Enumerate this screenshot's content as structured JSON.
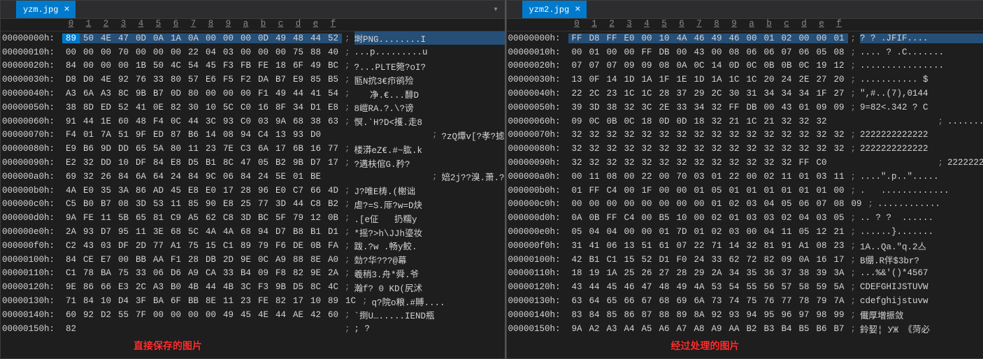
{
  "left": {
    "tab": "yzm.jpg",
    "ruler": [
      "0",
      "1",
      "2",
      "3",
      "4",
      "5",
      "6",
      "7",
      "8",
      "9",
      "a",
      "b",
      "c",
      "d",
      "e",
      "f"
    ],
    "rows": [
      {
        "off": "00000000h:",
        "hex": [
          "89",
          "50",
          "4E",
          "47",
          "0D",
          "0A",
          "1A",
          "0A",
          "00",
          "00",
          "00",
          "0D",
          "49",
          "48",
          "44",
          "52"
        ],
        "asc": "埘PNG........I"
      },
      {
        "off": "00000010h:",
        "hex": [
          "00",
          "00",
          "00",
          "70",
          "00",
          "00",
          "00",
          "22",
          "04",
          "03",
          "00",
          "00",
          "00",
          "75",
          "88",
          "40"
        ],
        "asc": "...p.........u"
      },
      {
        "off": "00000020h:",
        "hex": [
          "84",
          "00",
          "00",
          "00",
          "1B",
          "50",
          "4C",
          "54",
          "45",
          "F3",
          "FB",
          "FE",
          "18",
          "6F",
          "49",
          "BC"
        ],
        "asc": "?...PLTE箢?oI?"
      },
      {
        "off": "00000030h:",
        "hex": [
          "D8",
          "D0",
          "4E",
          "92",
          "76",
          "33",
          "80",
          "57",
          "E6",
          "F5",
          "F2",
          "DA",
          "B7",
          "E9",
          "85",
          "B5"
        ],
        "asc": "匦N抭3€疖鹆殓"
      },
      {
        "off": "00000040h:",
        "hex": [
          "A3",
          "6A",
          "A3",
          "8C",
          "9B",
          "B7",
          "0D",
          "80",
          "00",
          "00",
          "00",
          "F1",
          "49",
          "44",
          "41",
          "54"
        ],
        "asc": "   净.€...馡D"
      },
      {
        "off": "00000050h:",
        "hex": [
          "38",
          "8D",
          "ED",
          "52",
          "41",
          "0E",
          "82",
          "30",
          "10",
          "5C",
          "C0",
          "16",
          "8F",
          "34",
          "D1",
          "E8"
        ],
        "asc": "8嵦RA.?.\\?谤"
      },
      {
        "off": "00000060h:",
        "hex": [
          "91",
          "44",
          "1E",
          "60",
          "48",
          "F4",
          "0C",
          "44",
          "3C",
          "93",
          "C0",
          "03",
          "9A",
          "68",
          "38",
          "63"
        ],
        "asc": "慏.`H?D<擭.走8"
      },
      {
        "off": "00000070h:",
        "hex": [
          "F4",
          "01",
          "7A",
          "51",
          "9F",
          "ED",
          "87",
          "B6",
          "14",
          "08",
          "94",
          "C4",
          "13",
          "93",
          "D0",
          "",
          "",
          "",
          "",
          "",
          ""
        ],
        "asc": "?zQ燂v[?孝?摅"
      },
      {
        "off": "00000080h:",
        "hex": [
          "E9",
          "B6",
          "9D",
          "DD",
          "65",
          "5A",
          "80",
          "11",
          "23",
          "7E",
          "C3",
          "6A",
          "17",
          "6B",
          "16",
          "77"
        ],
        "asc": "楼漭eZ€.#~肱.k"
      },
      {
        "off": "00000090h:",
        "hex": [
          "E2",
          "32",
          "DD",
          "10",
          "DF",
          "84",
          "E8",
          "D5",
          "B1",
          "8C",
          "47",
          "05",
          "B2",
          "9B",
          "D7",
          "17"
        ],
        "asc": "?遘枎倌G.矜?"
      },
      {
        "off": "000000a0h:",
        "hex": [
          "69",
          "32",
          "26",
          "84",
          "6A",
          "64",
          "24",
          "84",
          "9C",
          "06",
          "84",
          "24",
          "5E",
          "01",
          "BE",
          "",
          "",
          "",
          "",
          "",
          ""
        ],
        "asc": "婄2j??溴.萧.?"
      },
      {
        "off": "000000b0h:",
        "hex": [
          "4A",
          "E0",
          "35",
          "3A",
          "86",
          "AD",
          "45",
          "E8",
          "E0",
          "17",
          "28",
          "96",
          "E0",
          "C7",
          "66",
          "4D"
        ],
        "asc": "J?唯E梼.(榭诎"
      },
      {
        "off": "000000c0h:",
        "hex": [
          "C5",
          "B0",
          "B7",
          "08",
          "3D",
          "53",
          "11",
          "85",
          "90",
          "E8",
          "25",
          "77",
          "3D",
          "44",
          "C8",
          "B2"
        ],
        "asc": "虐?=S.厞?w=D炔"
      },
      {
        "off": "000000d0h:",
        "hex": [
          "9A",
          "FE",
          "11",
          "5B",
          "65",
          "81",
          "C9",
          "A5",
          "62",
          "C8",
          "3D",
          "BC",
          "5F",
          "79",
          "12",
          "0B"
        ],
        "asc": ".[e佂   扔糯y"
      },
      {
        "off": "000000e0h:",
        "hex": [
          "2A",
          "93",
          "D7",
          "95",
          "11",
          "3E",
          "68",
          "5C",
          "4A",
          "4A",
          "68",
          "94",
          "D7",
          "B8",
          "B1",
          "D1"
        ],
        "asc": "*摇?>h\\JJh瑬妆"
      },
      {
        "off": "000000f0h:",
        "hex": [
          "C2",
          "43",
          "03",
          "DF",
          "2D",
          "77",
          "A1",
          "75",
          "15",
          "C1",
          "89",
          "79",
          "F6",
          "DE",
          "0B",
          "FA"
        ],
        "asc": "跋.?w .畅y鲛."
      },
      {
        "off": "00000100h:",
        "hex": [
          "84",
          "CE",
          "E7",
          "00",
          "BB",
          "AA",
          "F1",
          "28",
          "DB",
          "2D",
          "9E",
          "0C",
          "A9",
          "88",
          "8E",
          "A0"
        ],
        "asc": "勎?华???@幕"
      },
      {
        "off": "00000110h:",
        "hex": [
          "C1",
          "78",
          "BA",
          "75",
          "33",
          "06",
          "D6",
          "A9",
          "CA",
          "33",
          "B4",
          "09",
          "F8",
          "82",
          "9E",
          "2A"
        ],
        "asc": "羲稍3.舟*舜.爷"
      },
      {
        "off": "00000120h:",
        "hex": [
          "9E",
          "86",
          "66",
          "E3",
          "2C",
          "A3",
          "B0",
          "4B",
          "44",
          "4B",
          "3C",
          "F3",
          "9B",
          "D5",
          "8C",
          "4C"
        ],
        "asc": "瀚f? 0 KD(尻沭"
      },
      {
        "off": "00000130h:",
        "hex": [
          "71",
          "84",
          "10",
          "D4",
          "3F",
          "BA",
          "6F",
          "BB",
          "8E",
          "11",
          "23",
          "FE",
          "82",
          "17",
          "10",
          "89",
          "1C"
        ],
        "asc": "q?院o粮.#賻...."
      },
      {
        "off": "00000140h:",
        "hex": [
          "60",
          "92",
          "D2",
          "55",
          "7F",
          "00",
          "00",
          "00",
          "00",
          "49",
          "45",
          "4E",
          "44",
          "AE",
          "42",
          "60"
        ],
        "asc": "`捯U….....IEND瓶"
      },
      {
        "off": "00000150h:",
        "hex": [
          "82",
          "",
          "",
          "",
          "",
          "",
          "",
          "",
          "",
          "",
          "",
          "",
          "",
          "",
          "",
          ""
        ],
        "asc": "; ?"
      }
    ],
    "annotation": "直接保存的图片"
  },
  "right": {
    "tab": "yzm2.jpg",
    "ruler": [
      "0",
      "1",
      "2",
      "3",
      "4",
      "5",
      "6",
      "7",
      "8",
      "9",
      "a",
      "b",
      "c",
      "d",
      "e",
      "f"
    ],
    "rows": [
      {
        "off": "00000000h:",
        "hex": [
          "FF",
          "D8",
          "FF",
          "E0",
          "00",
          "10",
          "4A",
          "46",
          "49",
          "46",
          "00",
          "01",
          "02",
          "00",
          "00",
          "01"
        ],
        "asc": "? ? .JFIF...."
      },
      {
        "off": "00000010h:",
        "hex": [
          "00",
          "01",
          "00",
          "00",
          "FF",
          "DB",
          "00",
          "43",
          "00",
          "08",
          "06",
          "06",
          "07",
          "06",
          "05",
          "08"
        ],
        "asc": ".... ? .C......."
      },
      {
        "off": "00000020h:",
        "hex": [
          "07",
          "07",
          "07",
          "09",
          "09",
          "08",
          "0A",
          "0C",
          "14",
          "0D",
          "0C",
          "0B",
          "0B",
          "0C",
          "19",
          "12"
        ],
        "asc": "................"
      },
      {
        "off": "00000030h:",
        "hex": [
          "13",
          "0F",
          "14",
          "1D",
          "1A",
          "1F",
          "1E",
          "1D",
          "1A",
          "1C",
          "1C",
          "20",
          "24",
          "2E",
          "27",
          "20"
        ],
        "asc": "........... $"
      },
      {
        "off": "00000040h:",
        "hex": [
          "22",
          "2C",
          "23",
          "1C",
          "1C",
          "28",
          "37",
          "29",
          "2C",
          "30",
          "31",
          "34",
          "34",
          "34",
          "1F",
          "27"
        ],
        "asc": "\",#..(7),0144"
      },
      {
        "off": "00000050h:",
        "hex": [
          "39",
          "3D",
          "38",
          "32",
          "3C",
          "2E",
          "33",
          "34",
          "32",
          "FF",
          "DB",
          "00",
          "43",
          "01",
          "09",
          "09"
        ],
        "asc": "9=82<.342 ? C"
      },
      {
        "off": "00000060h:",
        "hex": [
          "09",
          "0C",
          "0B",
          "0C",
          "18",
          "0D",
          "0D",
          "18",
          "32",
          "21",
          "1C",
          "21",
          "32",
          "32",
          "32",
          "",
          "",
          "",
          "",
          "",
          ""
        ],
        "asc": ".........2!.!2"
      },
      {
        "off": "00000070h:",
        "hex": [
          "32",
          "32",
          "32",
          "32",
          "32",
          "32",
          "32",
          "32",
          "32",
          "32",
          "32",
          "32",
          "32",
          "32",
          "32",
          "32"
        ],
        "asc": "2222222222222"
      },
      {
        "off": "00000080h:",
        "hex": [
          "32",
          "32",
          "32",
          "32",
          "32",
          "32",
          "32",
          "32",
          "32",
          "32",
          "32",
          "32",
          "32",
          "32",
          "32",
          "32"
        ],
        "asc": "2222222222222"
      },
      {
        "off": "00000090h:",
        "hex": [
          "32",
          "32",
          "32",
          "32",
          "32",
          "32",
          "32",
          "32",
          "32",
          "32",
          "32",
          "32",
          "32",
          "FF",
          "C0",
          "",
          "",
          "",
          "",
          "",
          ""
        ],
        "asc": "2222222222222"
      },
      {
        "off": "000000a0h:",
        "hex": [
          "00",
          "11",
          "08",
          "00",
          "22",
          "00",
          "70",
          "03",
          "01",
          "22",
          "00",
          "02",
          "11",
          "01",
          "03",
          "11"
        ],
        "asc": "....\".p..\"....."
      },
      {
        "off": "000000b0h:",
        "hex": [
          "01",
          "FF",
          "C4",
          "00",
          "1F",
          "00",
          "00",
          "01",
          "05",
          "01",
          "01",
          "01",
          "01",
          "01",
          "01",
          "00"
        ],
        "asc": ".   ............."
      },
      {
        "off": "000000c0h:",
        "hex": [
          "00",
          "00",
          "00",
          "00",
          "00",
          "00",
          "00",
          "00",
          "01",
          "02",
          "03",
          "04",
          "05",
          "06",
          "07",
          "08",
          "09"
        ],
        "asc": "............"
      },
      {
        "off": "000000d0h:",
        "hex": [
          "0A",
          "0B",
          "FF",
          "C4",
          "00",
          "B5",
          "10",
          "00",
          "02",
          "01",
          "03",
          "03",
          "02",
          "04",
          "03",
          "05"
        ],
        "asc": ".. ? ?  ......"
      },
      {
        "off": "000000e0h:",
        "hex": [
          "05",
          "04",
          "04",
          "00",
          "00",
          "01",
          "7D",
          "01",
          "02",
          "03",
          "00",
          "04",
          "11",
          "05",
          "12",
          "21"
        ],
        "asc": "......}......."
      },
      {
        "off": "000000f0h:",
        "hex": [
          "31",
          "41",
          "06",
          "13",
          "51",
          "61",
          "07",
          "22",
          "71",
          "14",
          "32",
          "81",
          "91",
          "A1",
          "08",
          "23"
        ],
        "asc": "1A..Qa.\"q.2亼"
      },
      {
        "off": "00000100h:",
        "hex": [
          "42",
          "B1",
          "C1",
          "15",
          "52",
          "D1",
          "F0",
          "24",
          "33",
          "62",
          "72",
          "82",
          "09",
          "0A",
          "16",
          "17"
        ],
        "asc": "B绷.R伴$3br?"
      },
      {
        "off": "00000110h:",
        "hex": [
          "18",
          "19",
          "1A",
          "25",
          "26",
          "27",
          "28",
          "29",
          "2A",
          "34",
          "35",
          "36",
          "37",
          "38",
          "39",
          "3A"
        ],
        "asc": "...%&'()*4567"
      },
      {
        "off": "00000120h:",
        "hex": [
          "43",
          "44",
          "45",
          "46",
          "47",
          "48",
          "49",
          "4A",
          "53",
          "54",
          "55",
          "56",
          "57",
          "58",
          "59",
          "5A"
        ],
        "asc": "CDEFGHIJSTUVW"
      },
      {
        "off": "00000130h:",
        "hex": [
          "63",
          "64",
          "65",
          "66",
          "67",
          "68",
          "69",
          "6A",
          "73",
          "74",
          "75",
          "76",
          "77",
          "78",
          "79",
          "7A"
        ],
        "asc": "cdefghijstuvw"
      },
      {
        "off": "00000140h:",
        "hex": [
          "83",
          "84",
          "85",
          "86",
          "87",
          "88",
          "89",
          "8A",
          "92",
          "93",
          "94",
          "95",
          "96",
          "97",
          "98",
          "99"
        ],
        "asc": "儎厚増振敛"
      },
      {
        "off": "00000150h:",
        "hex": [
          "9A",
          "A2",
          "A3",
          "A4",
          "A5",
          "A6",
          "A7",
          "A8",
          "A9",
          "AA",
          "B2",
          "B3",
          "B4",
          "B5",
          "B6",
          "B7"
        ],
        "asc": "鈴㛃¦ УЖ ｟菏必"
      }
    ],
    "annotation": "经过处理的图片"
  }
}
